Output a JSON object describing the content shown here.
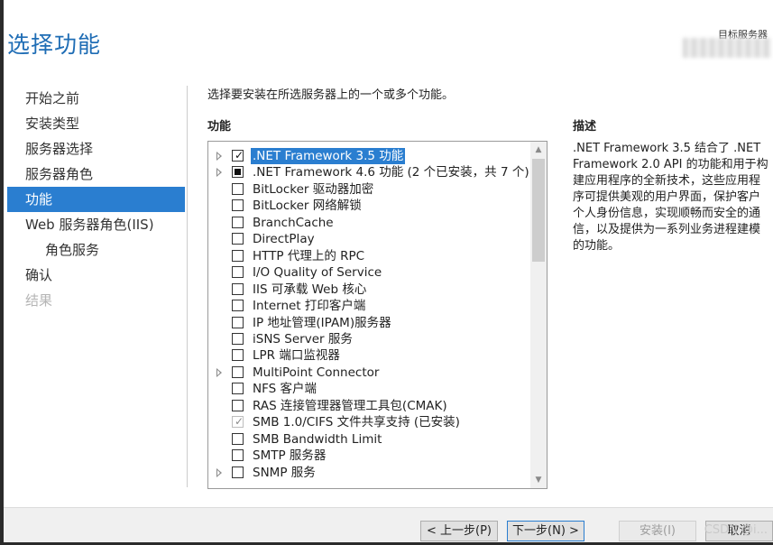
{
  "window": {
    "title": "选择功能",
    "destination_label": "目标服务器"
  },
  "nav": {
    "items": [
      {
        "label": "开始之前",
        "state": "normal"
      },
      {
        "label": "安装类型",
        "state": "normal"
      },
      {
        "label": "服务器选择",
        "state": "normal"
      },
      {
        "label": "服务器角色",
        "state": "normal"
      },
      {
        "label": "功能",
        "state": "active"
      },
      {
        "label": "Web 服务器角色(IIS)",
        "state": "normal"
      },
      {
        "label": "角色服务",
        "state": "sub"
      },
      {
        "label": "确认",
        "state": "normal"
      },
      {
        "label": "结果",
        "state": "disabled"
      }
    ]
  },
  "main": {
    "instruction": "选择要安装在所选服务器上的一个或多个功能。",
    "features_heading": "功能",
    "description_heading": "描述",
    "features": [
      {
        "label": ".NET Framework 3.5 功能",
        "expandable": true,
        "check": "checked",
        "selected": true
      },
      {
        "label": ".NET Framework 4.6 功能 (2 个已安装，共 7 个)",
        "expandable": true,
        "check": "partial",
        "selected": false
      },
      {
        "label": "BitLocker 驱动器加密",
        "expandable": false,
        "check": "unchecked",
        "selected": false
      },
      {
        "label": "BitLocker 网络解锁",
        "expandable": false,
        "check": "unchecked",
        "selected": false
      },
      {
        "label": "BranchCache",
        "expandable": false,
        "check": "unchecked",
        "selected": false
      },
      {
        "label": "DirectPlay",
        "expandable": false,
        "check": "unchecked",
        "selected": false
      },
      {
        "label": "HTTP 代理上的 RPC",
        "expandable": false,
        "check": "unchecked",
        "selected": false
      },
      {
        "label": "I/O Quality of Service",
        "expandable": false,
        "check": "unchecked",
        "selected": false
      },
      {
        "label": "IIS 可承载 Web 核心",
        "expandable": false,
        "check": "unchecked",
        "selected": false
      },
      {
        "label": "Internet 打印客户端",
        "expandable": false,
        "check": "unchecked",
        "selected": false
      },
      {
        "label": "IP 地址管理(IPAM)服务器",
        "expandable": false,
        "check": "unchecked",
        "selected": false
      },
      {
        "label": "iSNS Server 服务",
        "expandable": false,
        "check": "unchecked",
        "selected": false
      },
      {
        "label": "LPR 端口监视器",
        "expandable": false,
        "check": "unchecked",
        "selected": false
      },
      {
        "label": "MultiPoint Connector",
        "expandable": true,
        "check": "unchecked",
        "selected": false
      },
      {
        "label": "NFS 客户端",
        "expandable": false,
        "check": "unchecked",
        "selected": false
      },
      {
        "label": "RAS 连接管理器管理工具包(CMAK)",
        "expandable": false,
        "check": "unchecked",
        "selected": false
      },
      {
        "label": "SMB 1.0/CIFS 文件共享支持 (已安装)",
        "expandable": false,
        "check": "installed",
        "selected": false
      },
      {
        "label": "SMB Bandwidth Limit",
        "expandable": false,
        "check": "unchecked",
        "selected": false
      },
      {
        "label": "SMTP 服务器",
        "expandable": false,
        "check": "unchecked",
        "selected": false
      },
      {
        "label": "SNMP 服务",
        "expandable": true,
        "check": "unchecked",
        "selected": false
      }
    ],
    "description_lines": [
      ".NET Framework 3.5 结合了 .NET",
      "Framework 2.0 API 的功能和用于构",
      "建应用程序的全新技术，这些应用程",
      "序可提供美观的用户界面，保护客户",
      "个人身份信息，实现顺畅而安全的通",
      "信，以及提供为一系列业务进程建模",
      "的功能。"
    ]
  },
  "footer": {
    "prev_label": "< 上一步(P)",
    "next_label": "下一步(N) >",
    "install_label": "安装(I)",
    "cancel_label": "取消",
    "watermark": "CSDN @i..."
  },
  "colors": {
    "accent": "#2a7ed0",
    "title": "#1f6db5"
  }
}
